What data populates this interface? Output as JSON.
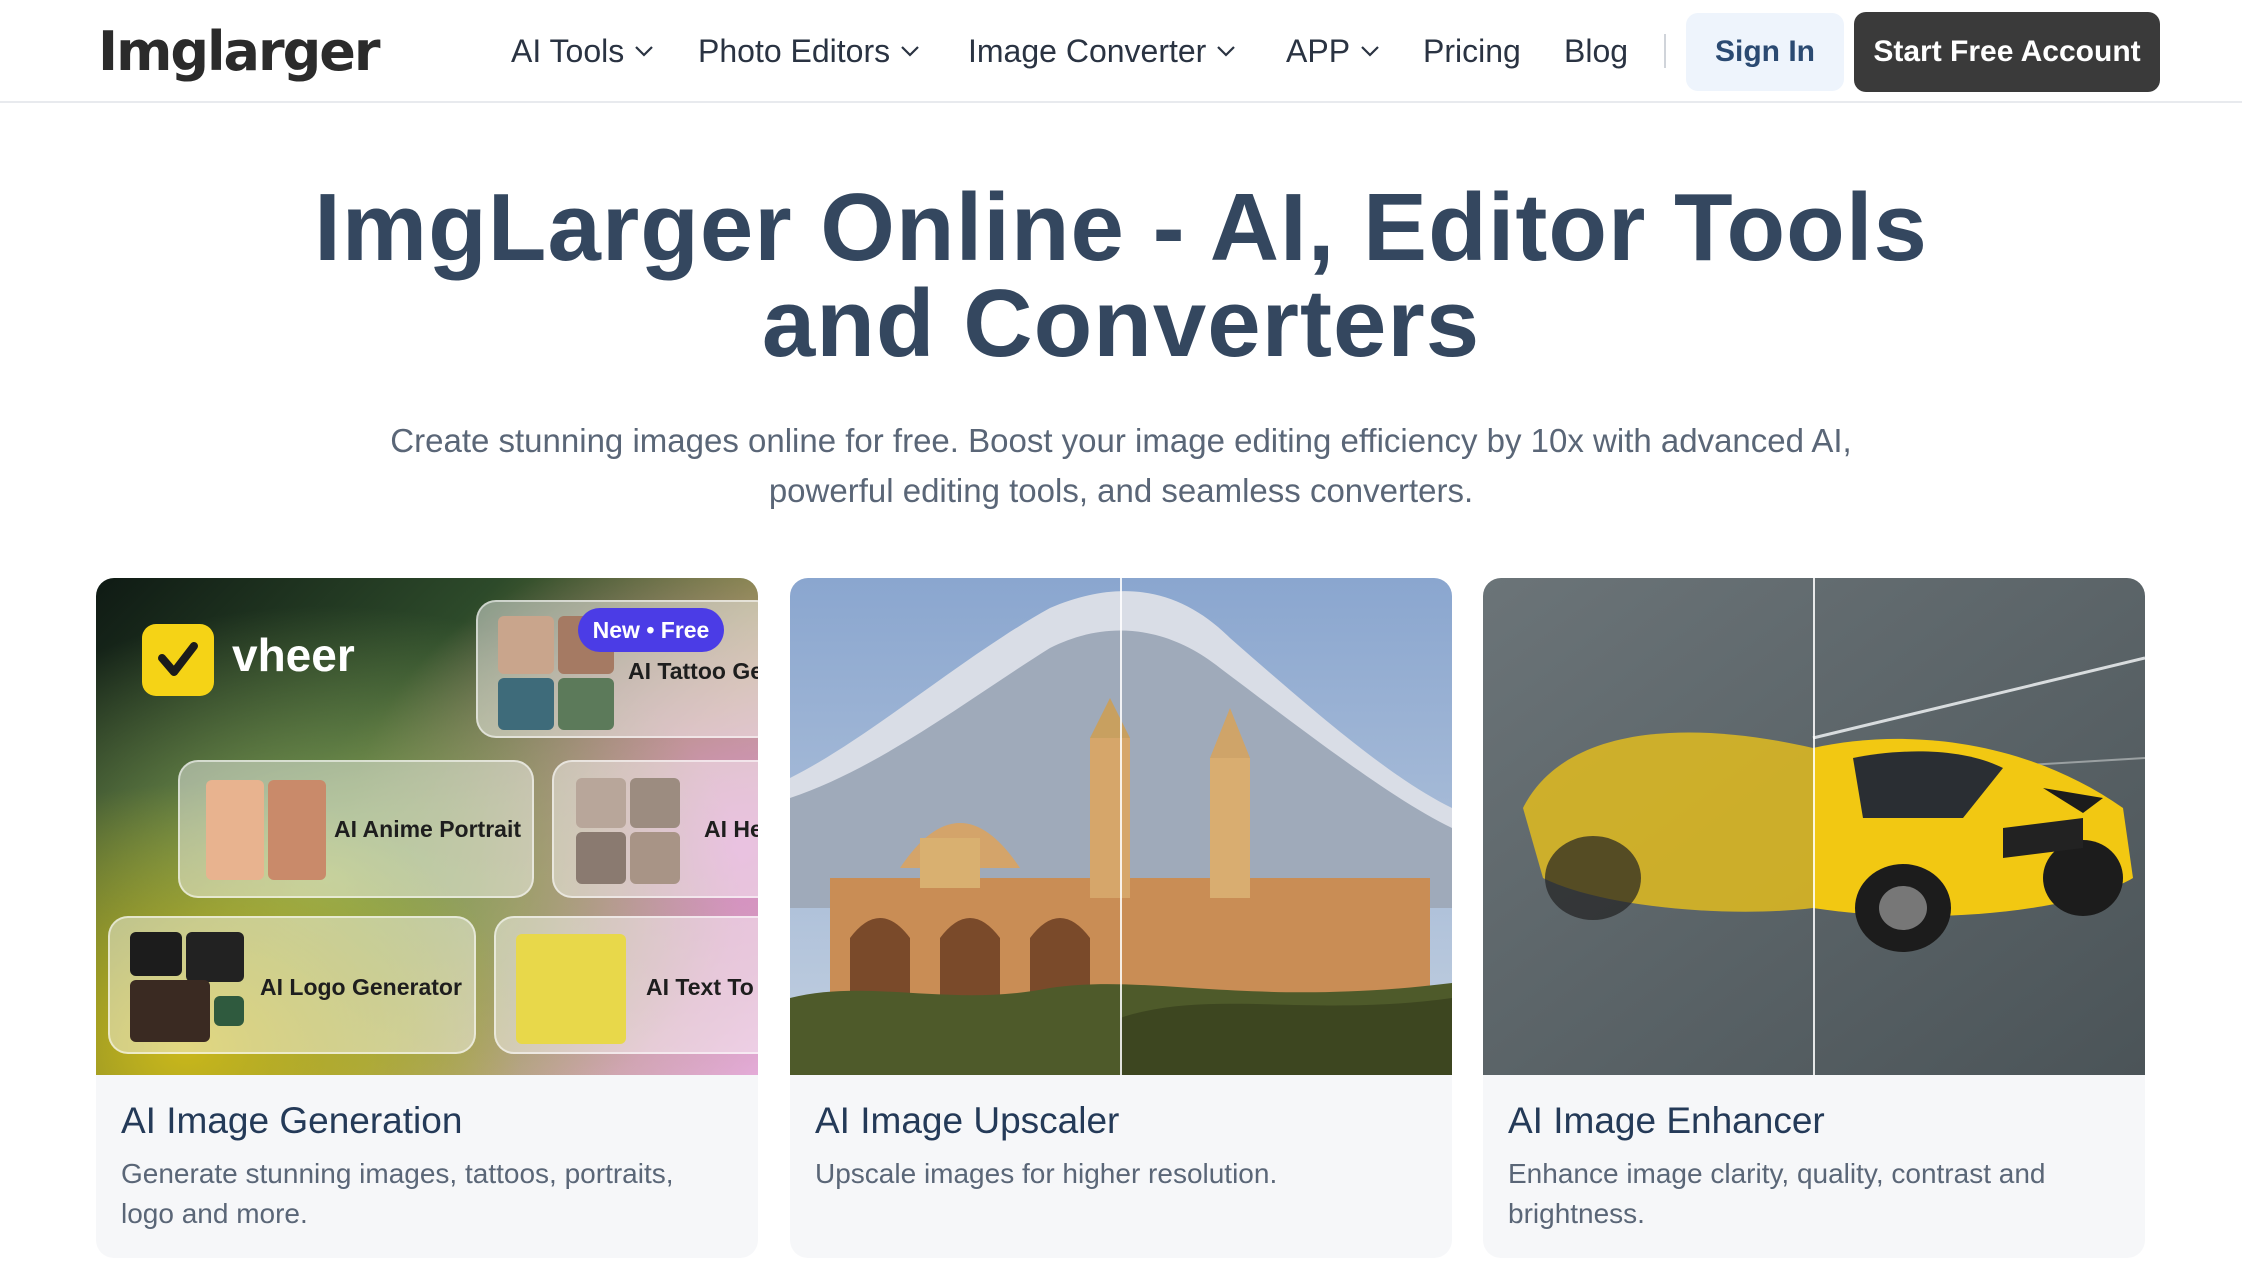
{
  "header": {
    "logo": "Imglarger",
    "nav": [
      {
        "label": "AI Tools",
        "dropdown": true
      },
      {
        "label": "Photo Editors",
        "dropdown": true
      },
      {
        "label": "Image Converter",
        "dropdown": true
      },
      {
        "label": "APP",
        "dropdown": true
      },
      {
        "label": "Pricing",
        "dropdown": false
      },
      {
        "label": "Blog",
        "dropdown": false
      }
    ],
    "sign_in": "Sign In",
    "start_free": "Start Free Account"
  },
  "hero": {
    "title_line1": "ImgLarger Online - AI, Editor Tools",
    "title_line2": "and Converters",
    "subtitle_line1": "Create stunning images online for free. Boost your image editing efficiency by 10x with advanced AI,",
    "subtitle_line2": "powerful editing tools, and seamless converters."
  },
  "cards": [
    {
      "title": "AI Image Generation",
      "desc_line1": "Generate stunning images, tattoos, portraits,",
      "desc_line2": "logo and more.",
      "image": {
        "brand": "vheer",
        "badge": "New • Free",
        "tiles": [
          "AI Tattoo Ge",
          "AI Anime Portrait",
          "AI He",
          "AI Logo Generator",
          "AI Text To I"
        ]
      }
    },
    {
      "title": "AI Image Upscaler",
      "desc_line1": "Upscale images for higher resolution.",
      "desc_line2": ""
    },
    {
      "title": "AI Image Enhancer",
      "desc_line1": "Enhance image clarity, quality, contrast and",
      "desc_line2": "brightness."
    }
  ],
  "colors": {
    "title": "#34475f",
    "start_button_bg": "#3a3a3a",
    "signin_bg": "#eef4fc",
    "badge_bg": "#4b3ce6",
    "vheer_accent": "#f5d316"
  }
}
